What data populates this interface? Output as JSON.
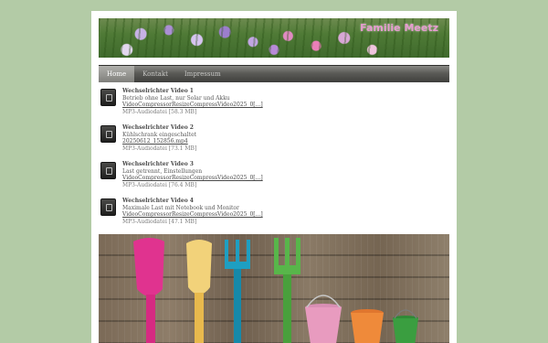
{
  "header": {
    "site_title": "Familie Meetz"
  },
  "nav": {
    "items": [
      {
        "label": "Home",
        "active": true
      },
      {
        "label": "Kontakt",
        "active": false
      },
      {
        "label": "Impressum",
        "active": false
      }
    ]
  },
  "downloads": [
    {
      "title": "Wechselrichter Video 1",
      "description": "Betrieb ohne Last, nur Solar und Akku",
      "filename": "VideoCompressorResizeCompressVideo2025_0[...]",
      "meta": "MP3-Audiodatei [58.3 MB]"
    },
    {
      "title": "Wechselrichter Video 2",
      "description": "Kühlschrank eingeschaltet",
      "filename": "20250612_152856.mp4",
      "meta": "MP3-Audiodatei [73.1 MB]"
    },
    {
      "title": "Wechselrichter Video 3",
      "description": "Last getrennt, Einstellungen",
      "filename": "VideoCompressorResizeCompressVideo2025_0[...]",
      "meta": "MP3-Audiodatei [76.4 MB]"
    },
    {
      "title": "Wechselrichter Video 4",
      "description": "Maximale Last mit Notebook und Monitor",
      "filename": "VideoCompressorResizeCompressVideo2025_0[...]",
      "meta": "MP3-Audiodatei [47.1 MB]"
    }
  ],
  "colors": {
    "background": "#b3cba6",
    "title_accent": "#e79bd0",
    "nav_bar": "#4a4a47"
  }
}
